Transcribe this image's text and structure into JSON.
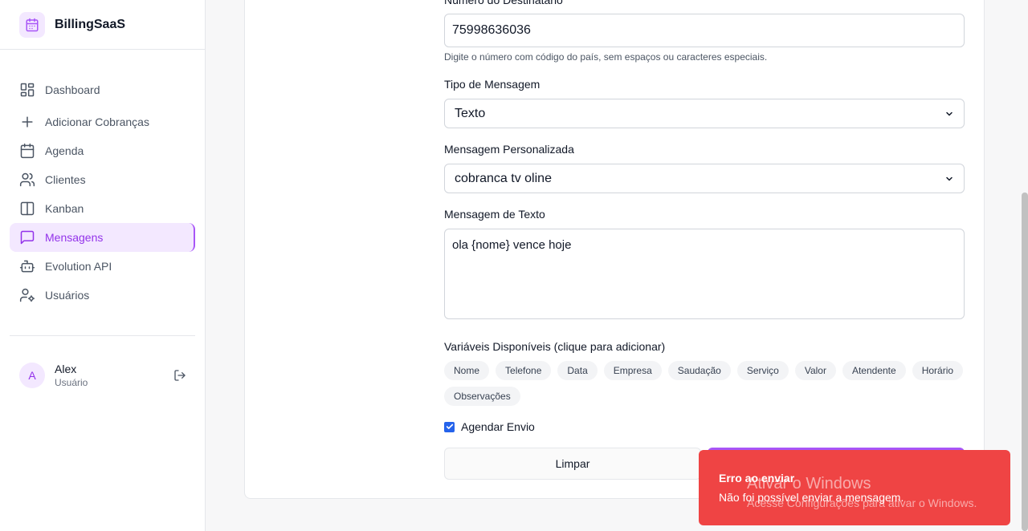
{
  "brand": {
    "name": "BillingSaaS"
  },
  "nav": [
    {
      "label": "Dashboard",
      "icon": "dashboard-icon"
    },
    {
      "label": "Adicionar Cobranças",
      "icon": "plus-icon"
    },
    {
      "label": "Agenda",
      "icon": "calendar-icon"
    },
    {
      "label": "Clientes",
      "icon": "users-icon"
    },
    {
      "label": "Kanban",
      "icon": "kanban-icon"
    },
    {
      "label": "Mensagens",
      "icon": "message-icon",
      "active": true
    },
    {
      "label": "Evolution API",
      "icon": "bot-icon"
    },
    {
      "label": "Usuários",
      "icon": "user-cog-icon"
    }
  ],
  "user": {
    "initial": "A",
    "name": "Alex",
    "role": "Usuário"
  },
  "form": {
    "recipient_label": "Número do Destinatário",
    "recipient_value": "75998636036",
    "recipient_hint": "Digite o número com código do país, sem espaços ou caracteres especiais.",
    "type_label": "Tipo de Mensagem",
    "type_value": "Texto",
    "custom_label": "Mensagem Personalizada",
    "custom_value": "cobranca tv oline",
    "text_label": "Mensagem de Texto",
    "text_value": "ola {nome} vence hoje",
    "vars_label": "Variáveis Disponíveis (clique para adicionar)",
    "vars": [
      "Nome",
      "Telefone",
      "Data",
      "Empresa",
      "Saudação",
      "Serviço",
      "Valor",
      "Atendente",
      "Horário",
      "Observações"
    ],
    "schedule_label": "Agendar Envio",
    "schedule_checked": true,
    "clear_label": "Limpar"
  },
  "toast": {
    "title": "Erro ao enviar",
    "description": "Não foi possível enviar a mensagem."
  },
  "watermark": {
    "title": "Ativar o Windows",
    "subtitle": "Acesse Configurações para ativar o Windows."
  },
  "colors": {
    "accent": "#a855f7",
    "accent_bg": "#f3e8ff",
    "error": "#ef4444"
  }
}
